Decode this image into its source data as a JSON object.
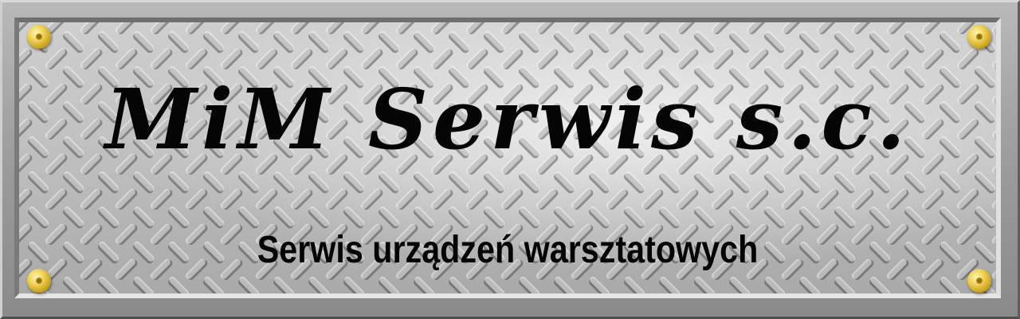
{
  "banner": {
    "title": "MiM Serwis s.c.",
    "subtitle": "Serwis urządzeń warsztatowych"
  },
  "colors": {
    "frame": "#9c9c9c",
    "plate": "#c4c4c4",
    "text": "#050505",
    "screw": "#e0c040"
  },
  "icons": {
    "screws": [
      "screw-icon",
      "screw-icon",
      "screw-icon",
      "screw-icon"
    ]
  }
}
